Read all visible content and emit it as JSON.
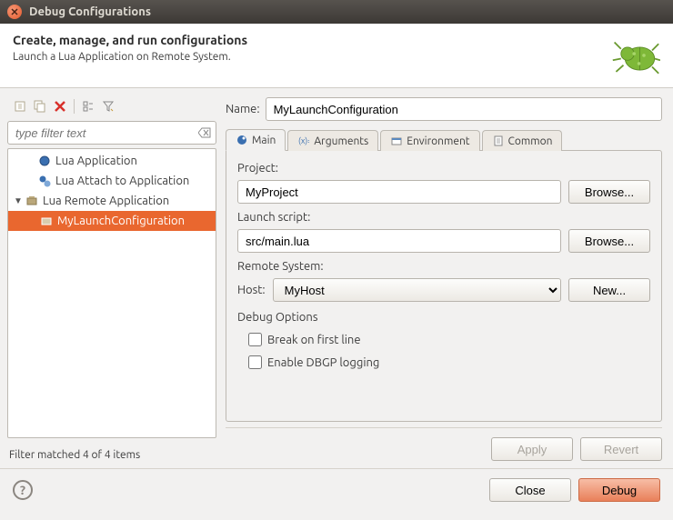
{
  "window": {
    "title": "Debug Configurations"
  },
  "header": {
    "title": "Create, manage, and run configurations",
    "subtitle": "Launch a Lua Application on Remote System."
  },
  "left": {
    "filter_placeholder": "type filter text",
    "tree": {
      "items": [
        {
          "label": "Lua Application"
        },
        {
          "label": "Lua Attach to Application"
        },
        {
          "label": "Lua Remote Application",
          "expanded": true
        },
        {
          "label": "MyLaunchConfiguration",
          "selected": true
        }
      ]
    },
    "status": "Filter matched 4 of 4 items"
  },
  "name_label": "Name:",
  "name_value": "MyLaunchConfiguration",
  "tabs": {
    "main": "Main",
    "arguments": "Arguments",
    "environment": "Environment",
    "common": "Common"
  },
  "main": {
    "project_label": "Project:",
    "project_value": "MyProject",
    "browse1": "Browse...",
    "script_label": "Launch script:",
    "script_value": "src/main.lua",
    "browse2": "Browse...",
    "remote_label": "Remote System:",
    "host_label": "Host:",
    "host_value": "MyHost",
    "new_btn": "New...",
    "debug_options_label": "Debug Options",
    "break_first": "Break on first line",
    "dbgp_logging": "Enable DBGP logging"
  },
  "buttons": {
    "apply": "Apply",
    "revert": "Revert",
    "close": "Close",
    "debug": "Debug"
  }
}
